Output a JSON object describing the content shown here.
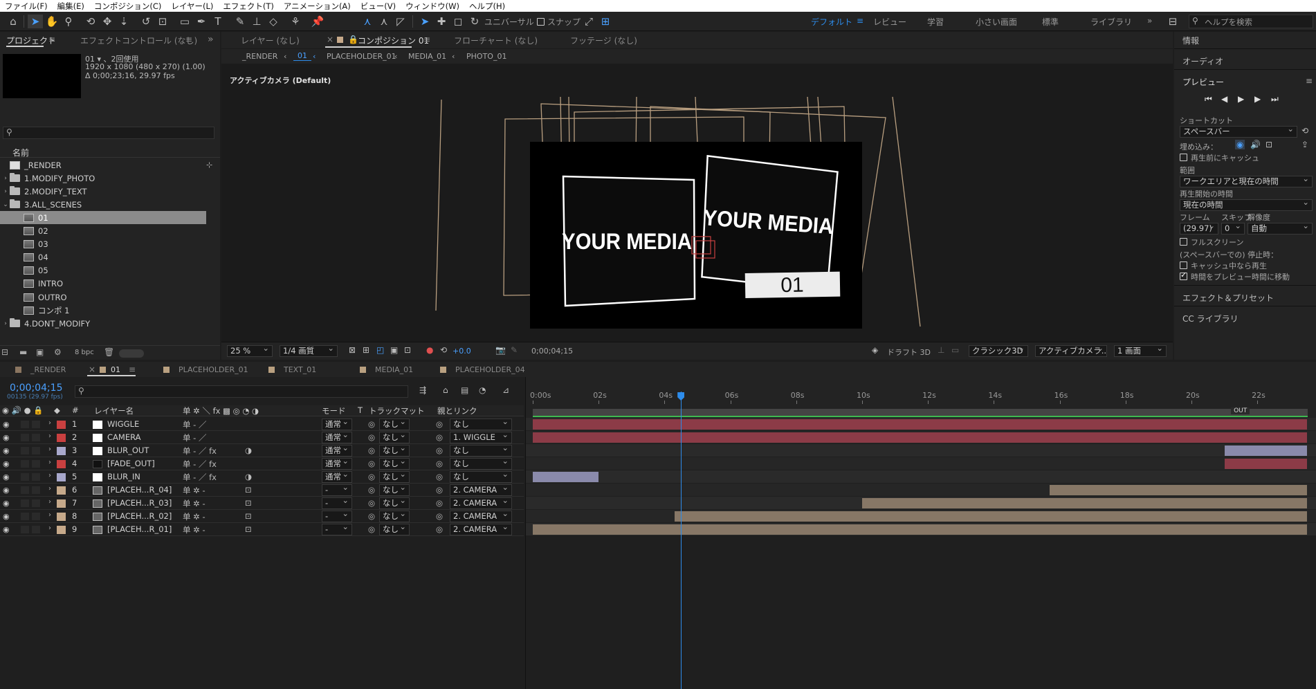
{
  "menu": [
    "ファイル(F)",
    "編集(E)",
    "コンポジション(C)",
    "レイヤー(L)",
    "エフェクト(T)",
    "アニメーション(A)",
    "ビュー(V)",
    "ウィンドウ(W)",
    "ヘルプ(H)"
  ],
  "toolbar": {
    "universal": "ユニバーサル",
    "snap": "スナップ",
    "help_placeholder": "ヘルプを検索"
  },
  "workspaces": [
    "デフォルト",
    "レビュー",
    "学習",
    "小さい画面",
    "標準",
    "ライブラリ"
  ],
  "project": {
    "tab": "プロジェクト",
    "effects_tab": "エフェクトコントロール (なし)",
    "item_name": "01 ▾ 、2回使用",
    "item_res": "1920 x 1080  (480 x 270) (1.00)",
    "item_dur": "Δ 0;00;23;16, 29.97 fps",
    "col_name": "名前",
    "bpc": "8 bpc",
    "items": [
      {
        "label": "_RENDER",
        "type": "comp",
        "indent": 0
      },
      {
        "label": "1.MODIFY_PHOTO",
        "type": "folder",
        "indent": 0,
        "caret": "›"
      },
      {
        "label": "2.MODIFY_TEXT",
        "type": "folder",
        "indent": 0,
        "caret": "›"
      },
      {
        "label": "3.ALL_SCENES",
        "type": "folder",
        "indent": 0,
        "caret": "⌄"
      },
      {
        "label": "01",
        "type": "comp",
        "indent": 1,
        "selected": true
      },
      {
        "label": "02",
        "type": "comp",
        "indent": 1
      },
      {
        "label": "03",
        "type": "comp",
        "indent": 1
      },
      {
        "label": "04",
        "type": "comp",
        "indent": 1
      },
      {
        "label": "05",
        "type": "comp",
        "indent": 1
      },
      {
        "label": "INTRO",
        "type": "comp",
        "indent": 1
      },
      {
        "label": "OUTRO",
        "type": "comp",
        "indent": 1
      },
      {
        "label": "コンポ 1",
        "type": "comp",
        "indent": 1
      },
      {
        "label": "4.DONT_MODIFY",
        "type": "folder",
        "indent": 0,
        "caret": "›"
      }
    ]
  },
  "viewer": {
    "tabs": [
      "レイヤー (なし)",
      "コンポジション 01",
      "フローチャート (なし)",
      "フッテージ (なし)"
    ],
    "crumbs": [
      "_RENDER",
      "01",
      "PLACEHOLDER_01",
      "MEDIA_01",
      "PHOTO_01"
    ],
    "camera_label": "アクティブカメラ (Default)",
    "media_text_left": "YOUR MEDIA",
    "media_text_right": "YOUR MEDIA",
    "number": "01",
    "zoom": "25 %",
    "quality": "1/4 画質",
    "exposure": "+0.0",
    "time": "0;00;04;15",
    "draft": "ドラフト 3D",
    "renderer": "クラシック3D",
    "view": "アクティブカメラ...",
    "layout": "1 画面"
  },
  "right": {
    "info": "情報",
    "audio": "オーディオ",
    "preview": "プレビュー",
    "shortcut_label": "ショートカット",
    "shortcut": "スペースバー",
    "embed_label": "埋め込み：",
    "cache_before": "再生前にキャッシュ",
    "range_label": "範囲",
    "range": "ワークエリアと現在の時間",
    "start_label": "再生開始の時間",
    "start": "現在の時間",
    "frame_label": "フレーム",
    "skip_label": "スキップ",
    "res_label": "解像度",
    "frame": "(29.97)",
    "skip": "0",
    "res": "自動",
    "fullscreen": "フルスクリーン",
    "stop_label": "(スペースバーでの) 停止時：",
    "cache_play": "キャッシュ中なら再生",
    "move_time": "時間をプレビュー時間に移動",
    "effects": "エフェクト＆プリセット",
    "cc": "CC ライブラリ"
  },
  "timeline": {
    "tabs": [
      "_RENDER",
      "01",
      "PLACEHOLDER_01",
      "TEXT_01",
      "MEDIA_01",
      "PLACEHOLDER_04"
    ],
    "tab_colors": [
      "#8a7560",
      "#b9a080",
      "#b9a080",
      "#b9a080",
      "#b9a080",
      "#b9a080"
    ],
    "timecode": "0;00;04;15",
    "frame_info": "00135 (29.97 fps)",
    "headers": {
      "name": "レイヤー名",
      "mode": "モード",
      "t": "T",
      "matte": "トラックマット",
      "parent": "親とリンク"
    },
    "layers": [
      {
        "num": "1",
        "name": "WIGGLE",
        "color": "#c94040",
        "icon": "white",
        "mode": "通常",
        "matte": "なし",
        "parent": "なし",
        "bar": {
          "start": 0,
          "end": 23.5
        },
        "barcolor": "#8c3b47"
      },
      {
        "num": "2",
        "name": "CAMERA",
        "color": "#c94040",
        "icon": "white",
        "mode": "通常",
        "matte": "なし",
        "parent": "1. WIGGLE",
        "bar": {
          "start": 0,
          "end": 23.5
        },
        "barcolor": "#8c3b47"
      },
      {
        "num": "3",
        "name": "BLUR_OUT",
        "color": "#a8a8cc",
        "icon": "white",
        "mode": "通常",
        "matte": "なし",
        "parent": "なし",
        "bar": {
          "start": 21.0,
          "end": 23.5
        },
        "barcolor": "#8a8aab"
      },
      {
        "num": "4",
        "name": "[FADE_OUT]",
        "color": "#c94040",
        "icon": "black",
        "mode": "通常",
        "matte": "なし",
        "parent": "なし",
        "bar": {
          "start": 21.0,
          "end": 23.5
        },
        "barcolor": "#8c3b47"
      },
      {
        "num": "5",
        "name": "BLUR_IN",
        "color": "#a8a8cc",
        "icon": "white",
        "mode": "通常",
        "matte": "なし",
        "parent": "なし",
        "bar": {
          "start": 0,
          "end": 2.0
        },
        "barcolor": "#8a8aab"
      },
      {
        "num": "6",
        "name": "[PLACEH...R_04]",
        "color": "#c6a98a",
        "icon": "comp",
        "mode": "-",
        "matte": "なし",
        "parent": "2. CAMERA",
        "bar": {
          "start": 15.7,
          "end": 23.5
        },
        "barcolor": "#877766"
      },
      {
        "num": "7",
        "name": "[PLACEH...R_03]",
        "color": "#c6a98a",
        "icon": "comp",
        "mode": "-",
        "matte": "なし",
        "parent": "2. CAMERA",
        "bar": {
          "start": 10.0,
          "end": 23.5
        },
        "barcolor": "#877766"
      },
      {
        "num": "8",
        "name": "[PLACEH...R_02]",
        "color": "#c6a98a",
        "icon": "comp",
        "mode": "-",
        "matte": "なし",
        "parent": "2. CAMERA",
        "bar": {
          "start": 4.3,
          "end": 23.5
        },
        "barcolor": "#877766"
      },
      {
        "num": "9",
        "name": "[PLACEH...R_01]",
        "color": "#c6a98a",
        "icon": "comp",
        "mode": "-",
        "matte": "なし",
        "parent": "2. CAMERA",
        "bar": {
          "start": 0,
          "end": 23.5
        },
        "barcolor": "#877766"
      }
    ],
    "ticks": [
      "0:00s",
      "02s",
      "04s",
      "06s",
      "08s",
      "10s",
      "12s",
      "14s",
      "16s",
      "18s",
      "20s",
      "22s"
    ],
    "playhead_sec": 4.5,
    "out_label": "OUT"
  }
}
